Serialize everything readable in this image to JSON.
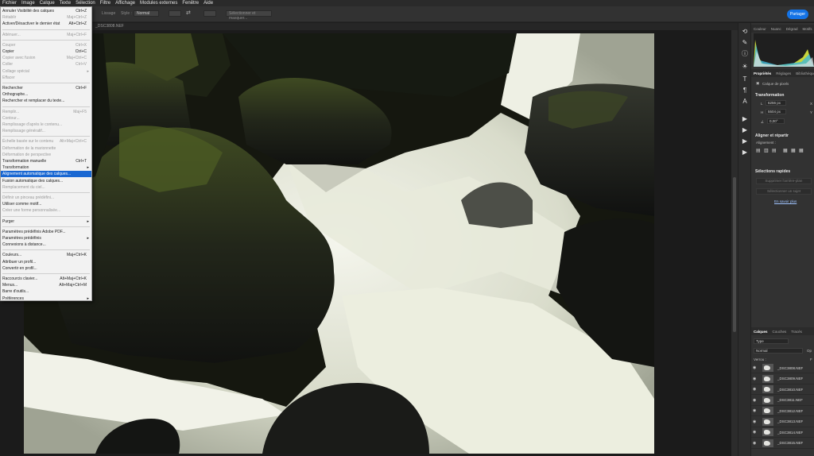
{
  "menubar": [
    "Fichier",
    "Image",
    "Calque",
    "Texte",
    "Sélection",
    "Filtre",
    "Affichage",
    "Modules externes",
    "Fenêtre",
    "Aide"
  ],
  "options": {
    "label1": "Lissage",
    "style_label": "Style :",
    "style_value": "Normal",
    "select_mask": "Sélectionner et masquer..."
  },
  "share_label": "Partager",
  "doc_tab": "_DSC3808.NEF",
  "edit_menu": [
    {
      "label": "Annuler Visibilité des calques",
      "shortcut": "Ctrl+Z",
      "disabled": false
    },
    {
      "label": "Rétablir",
      "shortcut": "Maj+Ctrl+Z",
      "disabled": true
    },
    {
      "label": "Activer/Désactiver le dernier état",
      "shortcut": "Alt+Ctrl+Z",
      "disabled": false
    },
    {
      "sep": true
    },
    {
      "label": "Atténuer...",
      "shortcut": "Maj+Ctrl+F",
      "disabled": true
    },
    {
      "sep": true
    },
    {
      "label": "Couper",
      "shortcut": "Ctrl+X",
      "disabled": true
    },
    {
      "label": "Copier",
      "shortcut": "Ctrl+C",
      "disabled": false
    },
    {
      "label": "Copier avec fusion",
      "shortcut": "Maj+Ctrl+C",
      "disabled": true
    },
    {
      "label": "Coller",
      "shortcut": "Ctrl+V",
      "disabled": true
    },
    {
      "label": "Collage spécial",
      "shortcut": "",
      "disabled": true,
      "submenu": true
    },
    {
      "label": "Effacer",
      "shortcut": "",
      "disabled": true
    },
    {
      "sep": true
    },
    {
      "label": "Rechercher",
      "shortcut": "Ctrl+F",
      "disabled": false
    },
    {
      "label": "Orthographe...",
      "shortcut": "",
      "disabled": false
    },
    {
      "label": "Rechercher et remplacer du texte...",
      "shortcut": "",
      "disabled": false
    },
    {
      "sep": true
    },
    {
      "label": "Remplir...",
      "shortcut": "Maj+F5",
      "disabled": true
    },
    {
      "label": "Contour...",
      "shortcut": "",
      "disabled": true
    },
    {
      "label": "Remplissage d'après le contenu...",
      "shortcut": "",
      "disabled": true
    },
    {
      "label": "Remplissage génératif...",
      "shortcut": "",
      "disabled": true
    },
    {
      "sep": true
    },
    {
      "label": "Échelle basée sur le contenu",
      "shortcut": "Alt+Maj+Ctrl+C",
      "disabled": true
    },
    {
      "label": "Déformation de la marionnette",
      "shortcut": "",
      "disabled": true
    },
    {
      "label": "Déformation de perspective",
      "shortcut": "",
      "disabled": true
    },
    {
      "label": "Transformation manuelle",
      "shortcut": "Ctrl+T",
      "disabled": false
    },
    {
      "label": "Transformation",
      "shortcut": "",
      "disabled": false,
      "submenu": true
    },
    {
      "label": "Alignement automatique des calques...",
      "shortcut": "",
      "disabled": false,
      "highlight": true
    },
    {
      "label": "Fusion automatique des calques...",
      "shortcut": "",
      "disabled": false
    },
    {
      "label": "Remplacement du ciel...",
      "shortcut": "",
      "disabled": true
    },
    {
      "sep": true
    },
    {
      "label": "Définir un pinceau prédéfini...",
      "shortcut": "",
      "disabled": true
    },
    {
      "label": "Utiliser comme motif...",
      "shortcut": "",
      "disabled": false
    },
    {
      "label": "Créer une forme personnalisée...",
      "shortcut": "",
      "disabled": true
    },
    {
      "sep": true
    },
    {
      "label": "Purger",
      "shortcut": "",
      "disabled": false,
      "submenu": true
    },
    {
      "sep": true
    },
    {
      "label": "Paramètres prédéfinis Adobe PDF...",
      "shortcut": "",
      "disabled": false
    },
    {
      "label": "Paramètres prédéfinis",
      "shortcut": "",
      "disabled": false,
      "submenu": true
    },
    {
      "label": "Connexions à distance...",
      "shortcut": "",
      "disabled": false
    },
    {
      "sep": true
    },
    {
      "label": "Couleurs...",
      "shortcut": "Maj+Ctrl+K",
      "disabled": false
    },
    {
      "label": "Attribuer un profil...",
      "shortcut": "",
      "disabled": false
    },
    {
      "label": "Convertir en profil...",
      "shortcut": "",
      "disabled": false
    },
    {
      "sep": true
    },
    {
      "label": "Raccourcis clavier...",
      "shortcut": "Alt+Maj+Ctrl+K",
      "disabled": false
    },
    {
      "label": "Menus...",
      "shortcut": "Alt+Maj+Ctrl+M",
      "disabled": false
    },
    {
      "label": "Barre d'outils...",
      "shortcut": "",
      "disabled": false
    },
    {
      "label": "Préférences",
      "shortcut": "",
      "disabled": false,
      "submenu": true
    }
  ],
  "top_panel_tabs": [
    "Couleur",
    "Nuanc",
    "Dégrad",
    "Motifs",
    "Hist"
  ],
  "props_tabs": [
    "Propriétés",
    "Réglages",
    "Bibliothèques"
  ],
  "props": {
    "layer_kind": "Calque de pixels",
    "transform_title": "Transformation",
    "w_label": "L",
    "w_value": "6256 px",
    "h_label": "H",
    "h_value": "5504 px",
    "x_label": "X",
    "y_label": "Y",
    "angle_value": "0,00°",
    "align_title": "Aligner et répartir",
    "align_sub": "Alignement :",
    "quick_title": "Sélections rapides",
    "btn_remove_bg": "Supprimer l'arrière-plan",
    "btn_select_subject": "Sélectionner un sujet",
    "learn_more": "En savoir plus"
  },
  "layers_tabs": [
    "Calques",
    "Couches",
    "Tracés"
  ],
  "layers_filter": "Type",
  "layers_mode": "Normal",
  "layers_opacity": "Op",
  "layers_lock": "Verrou :",
  "layers_fill": "F",
  "layers": [
    "_DSC3808.NEF",
    "_DSC3809.NEF",
    "_DSC3810.NEF",
    "_DSC3811.NEF",
    "_DSC3812.NEF",
    "_DSC3813.NEF",
    "_DSC3814.NEF",
    "_DSC3815.NEF"
  ]
}
